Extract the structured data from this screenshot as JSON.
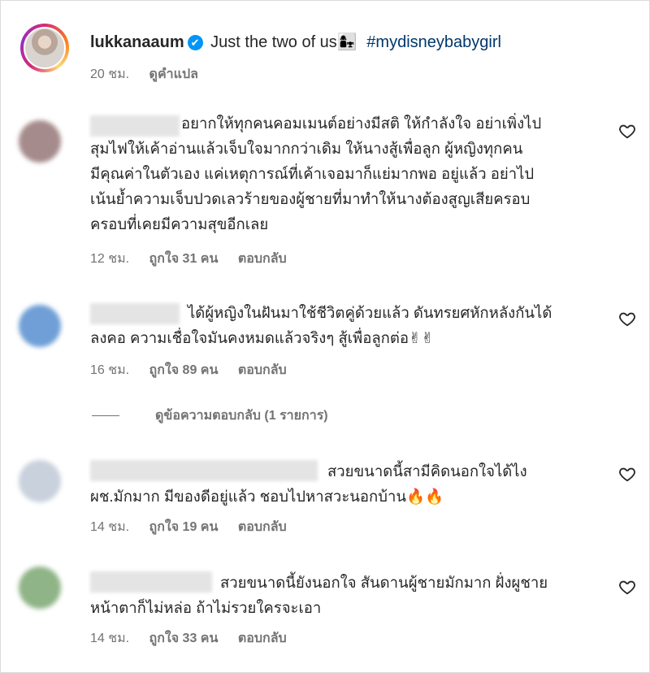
{
  "post": {
    "username": "lukkanaaum",
    "verified_mark": "✔",
    "caption": "Just the two of us",
    "caption_emoji": "👩‍👧",
    "hashtag": "#mydisneybabygirl",
    "time": "20 ชม.",
    "translate": "ดูคำแปล"
  },
  "comments": [
    {
      "text": "อยากให้ทุกคนคอมเมนต์อย่างมีสติ ให้กำลังใจ อย่าเพิ่งไป\nสุมไฟให้เค้าอ่านแล้วเจ็บใจมากกว่าเดิม ให้นางสู้เพื่อลูก ผู้หญิงทุกคน\nมีคุณค่าในตัวเอง แค่เหตุการณ์ที่เค้าเจอมาก็แย่มากพอ อยู่แล้ว อย่าไป\nเน้นย้ำความเจ็บปวดเลวร้ายของผู้ชายที่มาทำให้นางต้องสูญเสียครอบ\nครอบที่เคยมีความสุขอีกเลย",
      "time": "12 ชม.",
      "likes": "ถูกใจ 31 คน",
      "reply": "ตอบกลับ",
      "avatar_color": "#a58b8b"
    },
    {
      "text": "ได้ผู้หญิงในฝันมาใช้ชีวิตคู่ด้วยแล้ว ดันทรยศหักหลังกันได้\nลงคอ ความเชื่อใจมันคงหมดแล้วจริงๆ สู้เพื่อลูกต่อ✌✌",
      "time": "16 ชม.",
      "likes": "ถูกใจ 89 คน",
      "reply": "ตอบกลับ",
      "avatar_color": "#6f9fd6"
    },
    {
      "text": "สวยขนาดนี้สามีคิดนอกใจได้ไง\nผช.มักมาก มีของดีอยู่แล้ว ชอบไปหาสวะนอกบ้าน🔥🔥",
      "time": "14 ชม.",
      "likes": "ถูกใจ 19 คน",
      "reply": "ตอบกลับ",
      "avatar_color": "#c9d1dc"
    },
    {
      "text": "สวยขนาดนี้ยังนอกใจ สันดานผู้ชายมักมาก ฝั่งผูชาย\nหน้าตาก็ไม่หล่อ ถ้าไม่รวยใครจะเอา",
      "time": "14 ชม.",
      "likes": "ถูกใจ 33 คน",
      "reply": "ตอบกลับ",
      "avatar_color": "#8fb487"
    }
  ],
  "view_replies": "ดูข้อความตอบกลับ (1 รายการ)"
}
